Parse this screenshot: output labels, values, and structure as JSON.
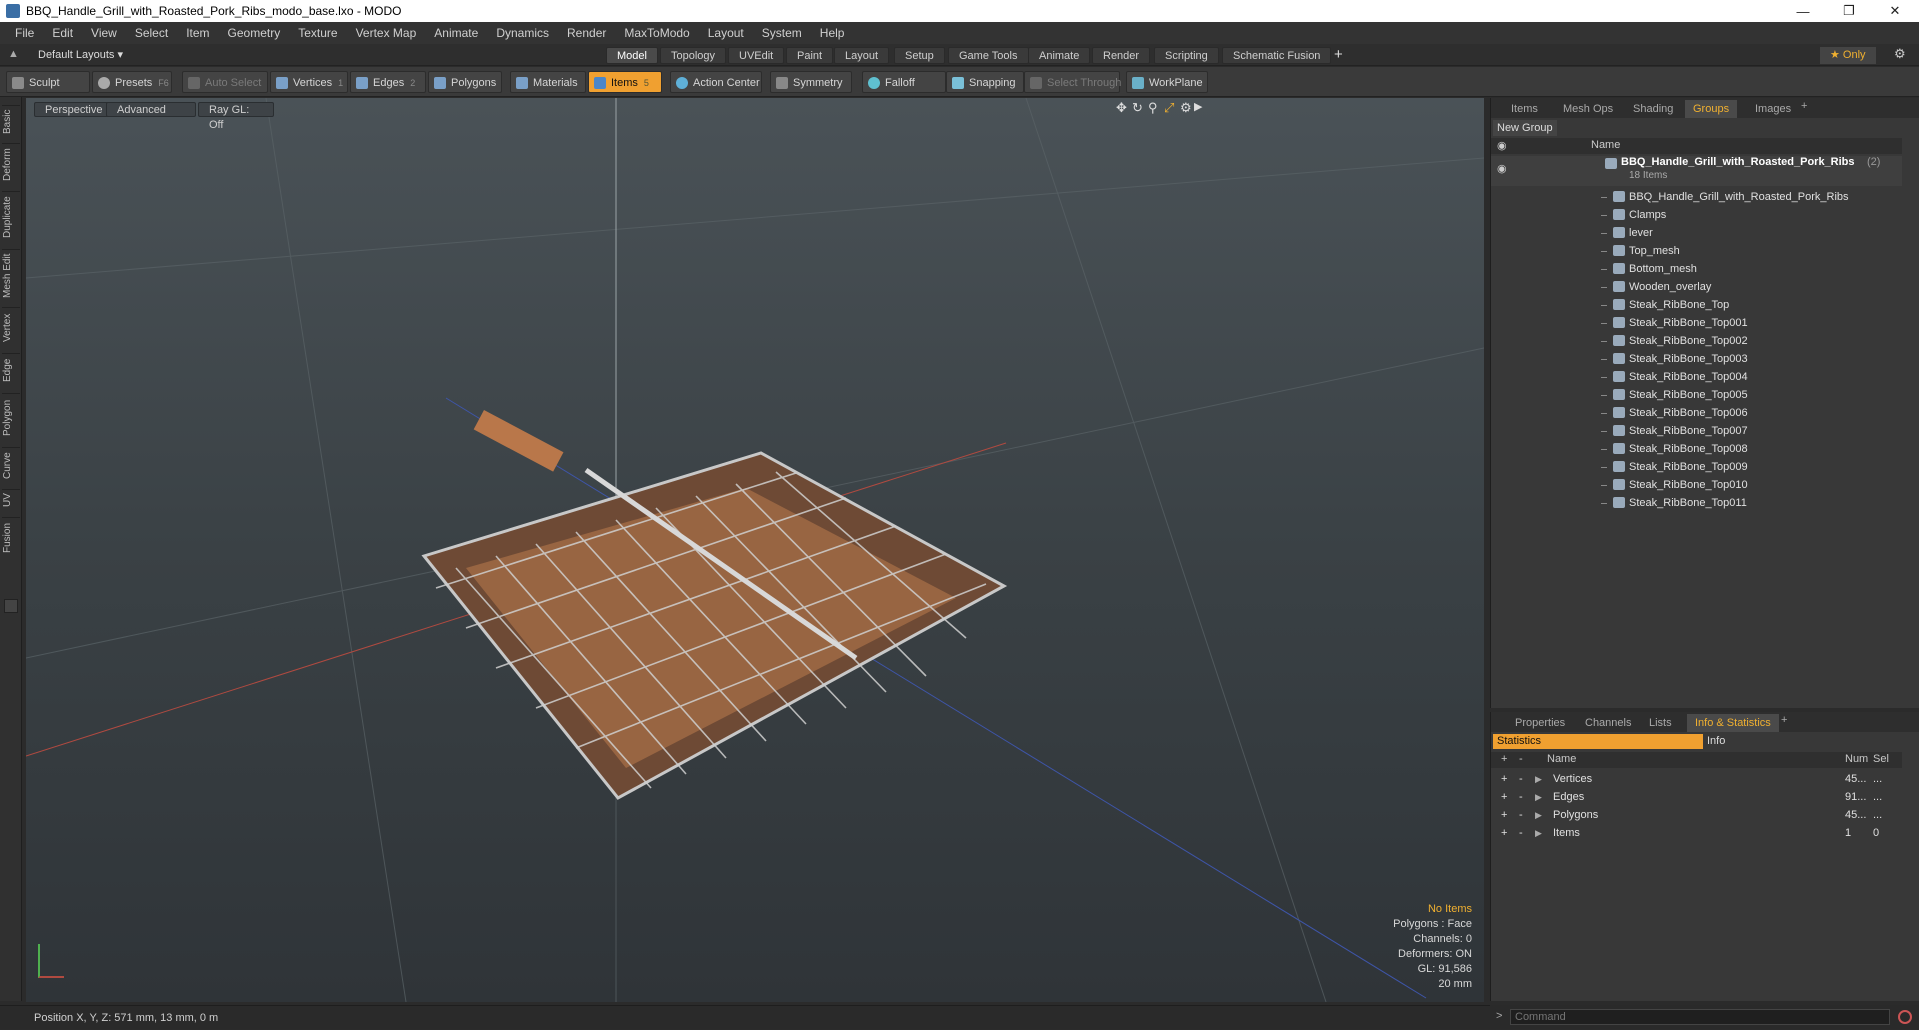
{
  "window": {
    "title": "BBQ_Handle_Grill_with_Roasted_Pork_Ribs_modo_base.lxo - MODO"
  },
  "menu": [
    "File",
    "Edit",
    "View",
    "Select",
    "Item",
    "Geometry",
    "Texture",
    "Vertex Map",
    "Animate",
    "Dynamics",
    "Render",
    "MaxToModo",
    "Layout",
    "System",
    "Help"
  ],
  "layout": {
    "preset": "Default Layouts ▾",
    "tabs": [
      "Model",
      "Topology",
      "UVEdit",
      "Paint",
      "Layout",
      "Setup",
      "Game Tools",
      "Animate",
      "Render",
      "Scripting",
      "Schematic Fusion"
    ],
    "active_tab": "Model",
    "add": "+",
    "only": "★ Only"
  },
  "toolbar": {
    "sculpt": "Sculpt",
    "presets": "Presets",
    "presets_key": "F6",
    "auto_select": "Auto Select",
    "vertices": "Vertices",
    "vertices_key": "1",
    "edges": "Edges",
    "edges_key": "2",
    "polygons": "Polygons",
    "materials": "Materials",
    "items": "Items",
    "items_key": "5",
    "action_center": "Action Center",
    "symmetry": "Symmetry",
    "falloff": "Falloff",
    "snapping": "Snapping",
    "select_through": "Select Through",
    "workplane": "WorkPlane"
  },
  "left_tabs": [
    "Basic",
    "Deform",
    "Duplicate",
    "Mesh Edit",
    "Vertex",
    "Edge",
    "Polygon",
    "Curve",
    "UV",
    "Fusion"
  ],
  "viewport": {
    "view": "Perspective",
    "shading": "Advanced",
    "raygl": "Ray GL: Off",
    "info": {
      "no_items": "No Items",
      "polygons": "Polygons : Face",
      "channels": "Channels: 0",
      "deformers": "Deformers: ON",
      "gl": "GL: 91,586",
      "scale": "20 mm"
    }
  },
  "status": {
    "position": "Position X, Y, Z:   571 mm, 13 mm, 0 m"
  },
  "groups_panel": {
    "tabs": [
      "Items",
      "Mesh Ops",
      "Shading",
      "Groups",
      "Images"
    ],
    "active_tab": "Groups",
    "new_group": "New Group",
    "name_header": "Name",
    "root": {
      "name": "BBQ_Handle_Grill_with_Roasted_Pork_Ribs",
      "count": "(2)",
      "sub": "18 Items"
    },
    "items": [
      "BBQ_Handle_Grill_with_Roasted_Pork_Ribs",
      "Clamps",
      "lever",
      "Top_mesh",
      "Bottom_mesh",
      "Wooden_overlay",
      "Steak_RibBone_Top",
      "Steak_RibBone_Top001",
      "Steak_RibBone_Top002",
      "Steak_RibBone_Top003",
      "Steak_RibBone_Top004",
      "Steak_RibBone_Top005",
      "Steak_RibBone_Top006",
      "Steak_RibBone_Top007",
      "Steak_RibBone_Top008",
      "Steak_RibBone_Top009",
      "Steak_RibBone_Top010",
      "Steak_RibBone_Top011"
    ]
  },
  "info_panel": {
    "tabs": [
      "Properties",
      "Channels",
      "Lists",
      "Info & Statistics"
    ],
    "active_tab": "Info & Statistics",
    "statistics": "Statistics",
    "info": "Info",
    "headers": {
      "name": "Name",
      "num": "Num",
      "sel": "Sel"
    },
    "rows": [
      {
        "name": "Vertices",
        "num": "45...",
        "sel": "..."
      },
      {
        "name": "Edges",
        "num": "91...",
        "sel": "..."
      },
      {
        "name": "Polygons",
        "num": "45...",
        "sel": "..."
      },
      {
        "name": "Items",
        "num": "1",
        "sel": "0"
      }
    ]
  },
  "command": {
    "placeholder": "Command",
    "prompt": ">"
  },
  "colors": {
    "accent": "#f0a030",
    "viewport_top": "#4a5257",
    "viewport_bottom": "#2f3438"
  }
}
